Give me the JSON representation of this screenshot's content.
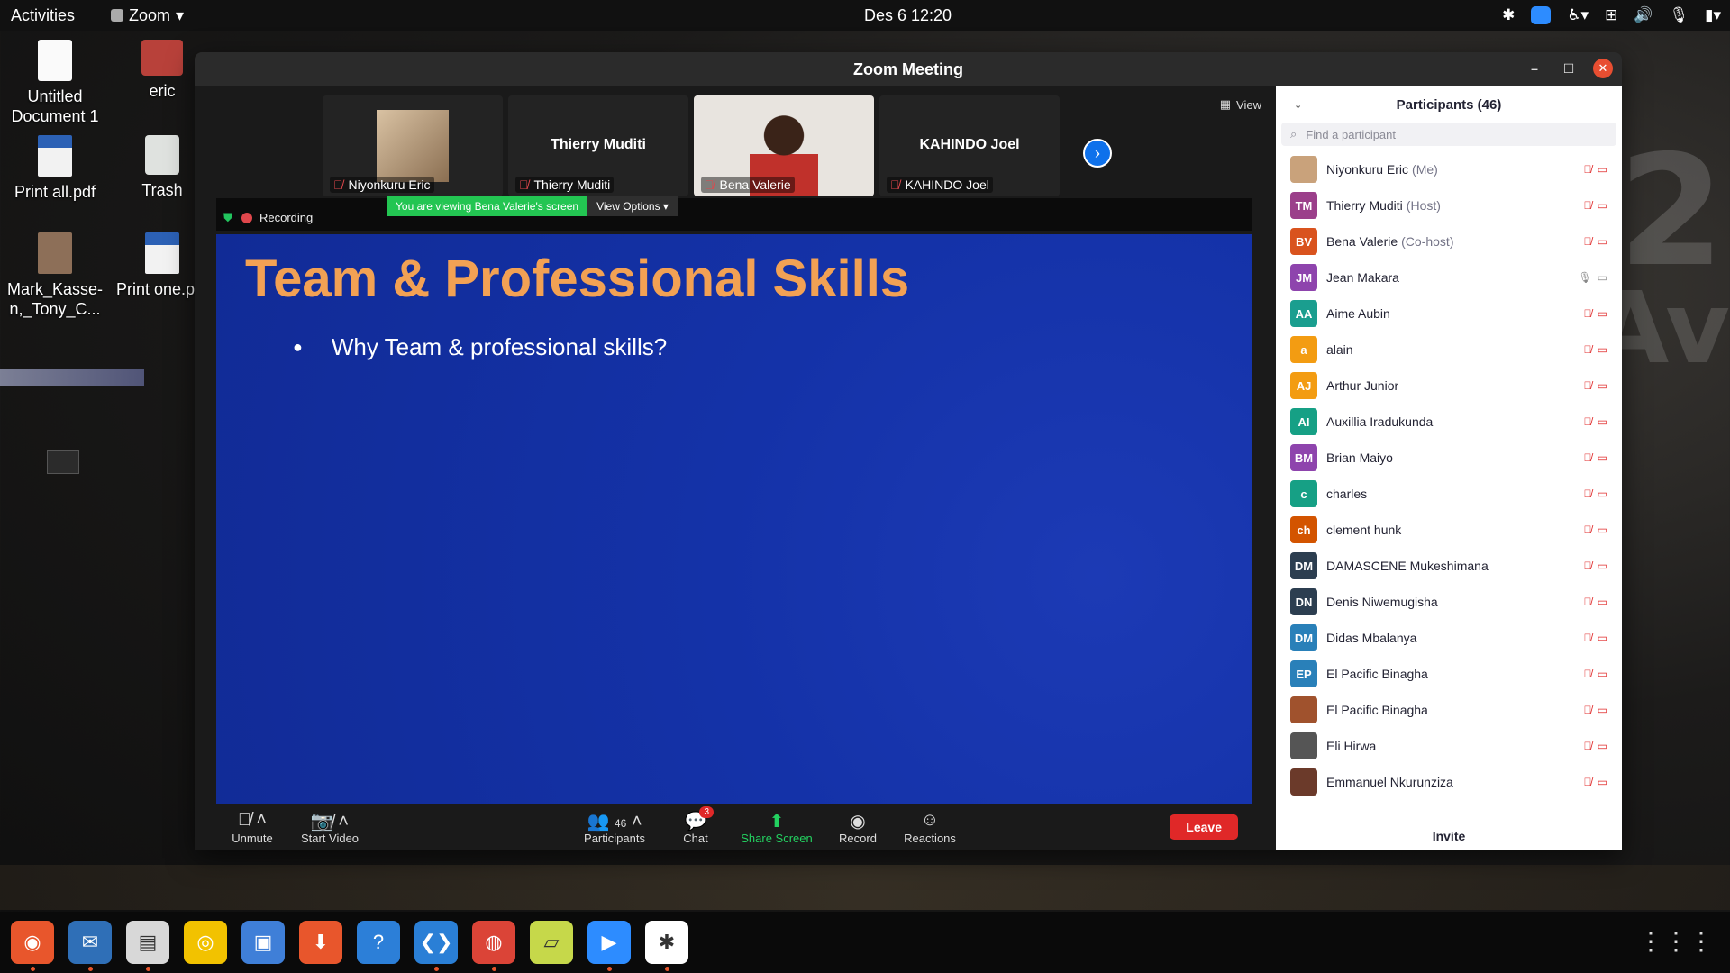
{
  "topbar": {
    "activities": "Activities",
    "app_menu": "Zoom",
    "clock": "Des 6  12:20"
  },
  "desktop": {
    "icons": [
      {
        "label": "Untitled Document 1",
        "type": "doc"
      },
      {
        "label": "eric",
        "type": "home"
      },
      {
        "label": "Print all.pdf",
        "type": "pdf"
      },
      {
        "label": "Trash",
        "type": "trash"
      },
      {
        "label": "Mark_Kasse-n,_Tony_C...",
        "type": "photo"
      },
      {
        "label": "Print one.pdf",
        "type": "pdf"
      }
    ]
  },
  "window": {
    "title": "Zoom Meeting",
    "view_label": "View"
  },
  "thumbnails": [
    {
      "name": "Niyonkuru Eric",
      "big": ""
    },
    {
      "name": "Thierry Muditi",
      "big": "Thierry Muditi"
    },
    {
      "name": "Bena Valerie",
      "big": ""
    },
    {
      "name": "KAHINDO Joel",
      "big": "KAHINDO Joel"
    }
  ],
  "share": {
    "recording": "Recording",
    "viewing": "You are viewing Bena Valerie's screen",
    "view_options": "View Options"
  },
  "slide": {
    "title": "Team & Professional Skills",
    "bullet": "Why Team & professional skills?"
  },
  "toolbar": {
    "unmute": "Unmute",
    "start_video": "Start Video",
    "participants": "Participants",
    "participant_count": "46",
    "chat": "Chat",
    "chat_badge": "3",
    "share_screen": "Share Screen",
    "record": "Record",
    "reactions": "Reactions",
    "leave": "Leave"
  },
  "panel": {
    "title": "Participants (46)",
    "search_placeholder": "Find a participant",
    "invite": "Invite",
    "participants": [
      {
        "name": "Niyonkuru Eric",
        "role": "(Me)",
        "initials": "",
        "color": "#c9a27b"
      },
      {
        "name": "Thierry Muditi",
        "role": "(Host)",
        "initials": "TM",
        "color": "#9b3f8a"
      },
      {
        "name": "Bena Valerie",
        "role": "(Co-host)",
        "initials": "BV",
        "color": "#d9531e"
      },
      {
        "name": "Jean Makara",
        "role": "",
        "initials": "JM",
        "color": "#8e44ad"
      },
      {
        "name": "Aime Aubin",
        "role": "",
        "initials": "AA",
        "color": "#1a9e8f"
      },
      {
        "name": "alain",
        "role": "",
        "initials": "a",
        "color": "#f39c12"
      },
      {
        "name": "Arthur Junior",
        "role": "",
        "initials": "AJ",
        "color": "#f39c12"
      },
      {
        "name": "Auxillia Iradukunda",
        "role": "",
        "initials": "AI",
        "color": "#16a085"
      },
      {
        "name": "Brian Maiyo",
        "role": "",
        "initials": "BM",
        "color": "#8e44ad"
      },
      {
        "name": "charles",
        "role": "",
        "initials": "c",
        "color": "#16a085"
      },
      {
        "name": "clement hunk",
        "role": "",
        "initials": "ch",
        "color": "#d35400"
      },
      {
        "name": "DAMASCENE Mukeshimana",
        "role": "",
        "initials": "DM",
        "color": "#2c3e50"
      },
      {
        "name": "Denis Niwemugisha",
        "role": "",
        "initials": "DN",
        "color": "#2c3e50"
      },
      {
        "name": "Didas Mbalanya",
        "role": "",
        "initials": "DM",
        "color": "#2980b9"
      },
      {
        "name": "El Pacific Binagha",
        "role": "",
        "initials": "EP",
        "color": "#2980b9"
      },
      {
        "name": "El Pacific Binagha",
        "role": "",
        "initials": "",
        "color": "#a0522d"
      },
      {
        "name": "Eli Hirwa",
        "role": "",
        "initials": "",
        "color": "#555555"
      },
      {
        "name": "Emmanuel Nkurunziza",
        "role": "",
        "initials": "",
        "color": "#6b3a2a"
      }
    ]
  },
  "colors": {
    "accent": "#0e71eb",
    "slide_bg": "#1432a8",
    "slide_title": "#f2a154",
    "leave": "#e02828",
    "share_green": "#23c552"
  },
  "dock": {
    "apps": [
      "firefox-icon",
      "thunderbird-icon",
      "files-icon",
      "rhythmbox-icon",
      "writer-icon",
      "software-icon",
      "help-icon",
      "vscode-icon",
      "chrome-icon",
      "notes-icon",
      "zoom-icon",
      "slack-icon"
    ]
  }
}
